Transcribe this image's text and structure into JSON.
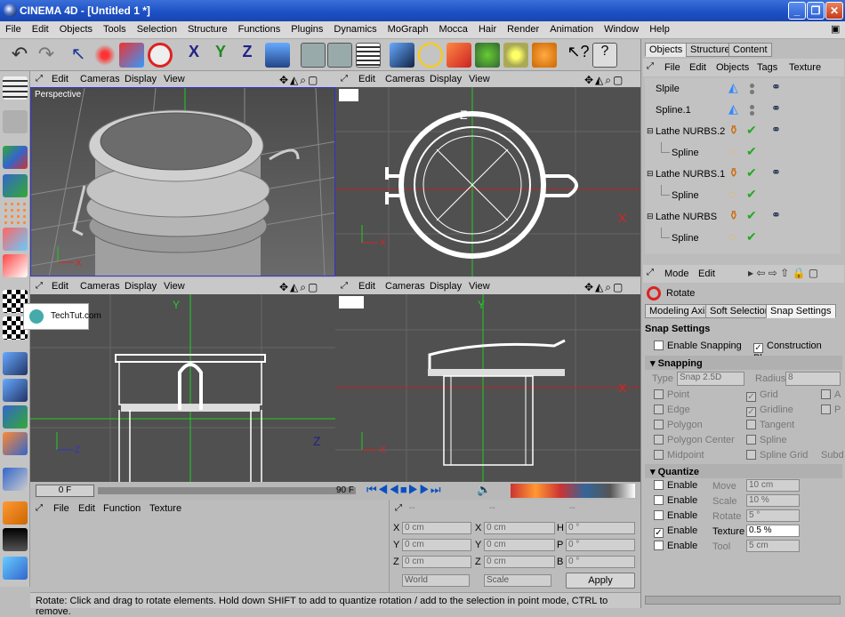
{
  "window": {
    "title": "CINEMA 4D - [Untitled 1 *]"
  },
  "menu": [
    "File",
    "Edit",
    "Objects",
    "Tools",
    "Selection",
    "Structure",
    "Functions",
    "Plugins",
    "Dynamics",
    "MoGraph",
    "Mocca",
    "Hair",
    "Render",
    "Animation",
    "Window",
    "Help"
  ],
  "viewport_menu": {
    "edit": "Edit",
    "cameras": "Cameras",
    "display": "Display",
    "view": "View"
  },
  "viewports": {
    "persp_label": "Perspective"
  },
  "axes": {
    "x": "X",
    "y": "Y",
    "z": "Z"
  },
  "watermark": "TechTut.com",
  "timeline": {
    "start": "0 F",
    "end": "90 F"
  },
  "bottom_menu": [
    "File",
    "Edit",
    "Function",
    "Texture"
  ],
  "coords": {
    "pos_header": "--",
    "size_header": "--",
    "rot_header": "--",
    "rows": [
      {
        "a": "X",
        "av": "0 cm",
        "b": "X",
        "bv": "0 cm",
        "c": "H",
        "cv": "0 °"
      },
      {
        "a": "Y",
        "av": "0 cm",
        "b": "Y",
        "bv": "0 cm",
        "c": "P",
        "cv": "0 °"
      },
      {
        "a": "Z",
        "av": "0 cm",
        "b": "Z",
        "bv": "0 cm",
        "c": "B",
        "cv": "0 °"
      }
    ],
    "world": "World",
    "scale": "Scale",
    "apply": "Apply"
  },
  "status": "Rotate: Click and drag to rotate elements. Hold down SHIFT to add to quantize rotation / add to the selection in point mode, CTRL to remove.",
  "tabs": [
    "Objects",
    "Structure",
    "Content"
  ],
  "objmenu": [
    "File",
    "Edit",
    "Objects",
    "Tags",
    "Texture"
  ],
  "objects": [
    "Slpile",
    "Spline.1",
    "Lathe NURBS.2",
    "Spline",
    "Lathe NURBS.1",
    "Spline",
    "Lathe NURBS",
    "Spline"
  ],
  "attr": {
    "mode": "Mode",
    "edit": "Edit",
    "tool": "Rotate",
    "subtabs": [
      "Modeling Axis",
      "Soft Selection",
      "Snap Settings"
    ],
    "section": "Snap Settings",
    "enable_snapping": "Enable Snapping",
    "construction_plane": "Construction Plane",
    "snapping": "Snapping",
    "type_label": "Type",
    "type_value": "Snap 2.5D",
    "radius_label": "Radius",
    "radius_value": "8",
    "snap_left": [
      "Point",
      "Edge",
      "Polygon",
      "Polygon Center",
      "Midpoint"
    ],
    "snap_right": [
      "Grid",
      "Gridline",
      "Tangent",
      "Spline",
      "Spline Grid"
    ],
    "snap_far": [
      "A",
      "P",
      "",
      "",
      "Subd"
    ],
    "quantize": "Quantize",
    "q_rows": [
      {
        "en": "Enable",
        "label": "Move",
        "value": "10 cm"
      },
      {
        "en": "Enable",
        "label": "Scale",
        "value": "10 %"
      },
      {
        "en": "Enable",
        "label": "Rotate",
        "value": "5 °"
      },
      {
        "en": "Enable",
        "label": "Texture",
        "value": "0.5 %"
      },
      {
        "en": "Enable",
        "label": "Tool",
        "value": "5 cm"
      }
    ]
  }
}
